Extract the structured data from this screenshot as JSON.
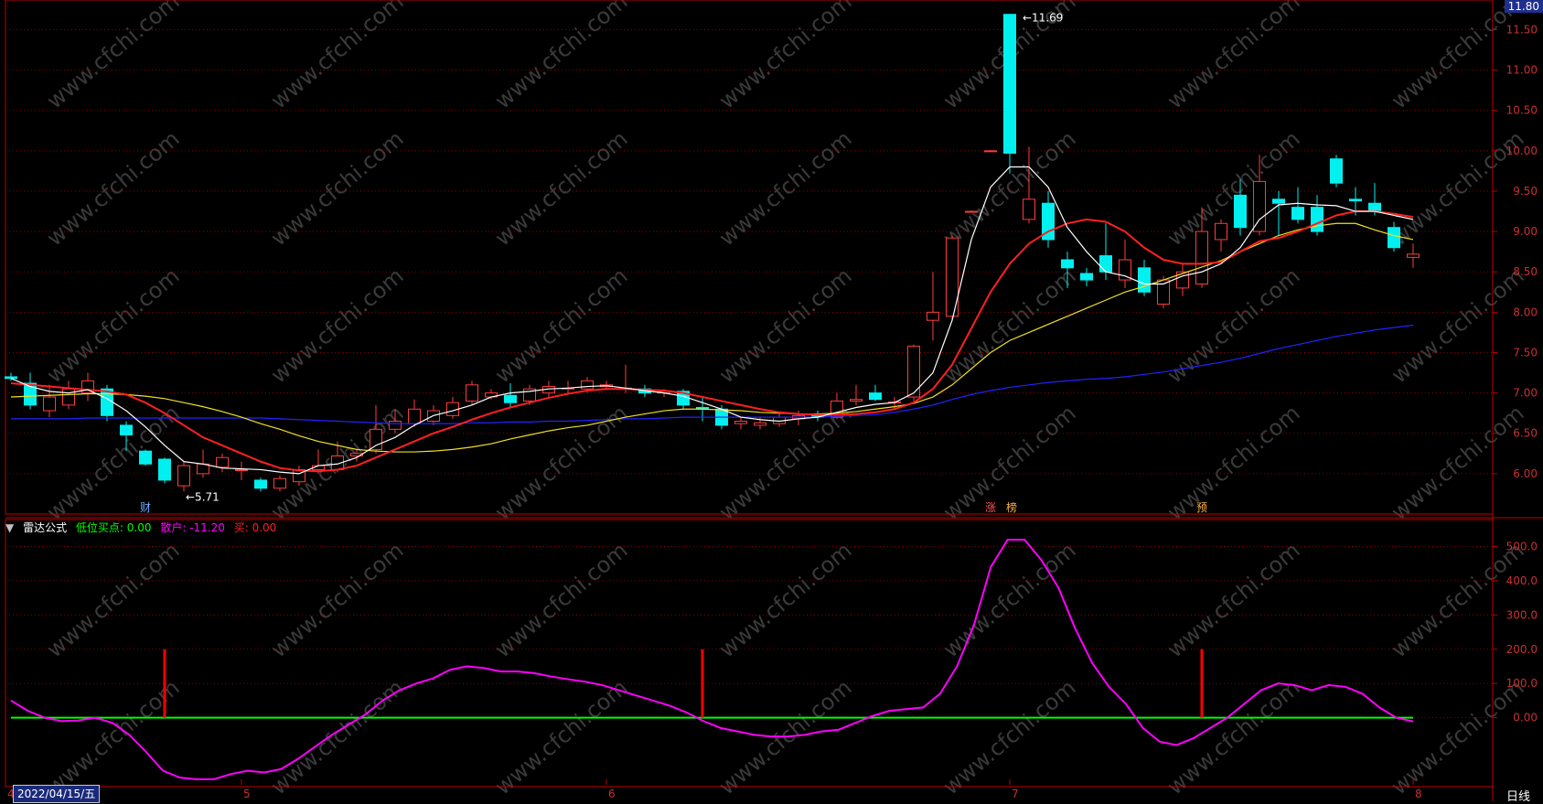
{
  "colors": {
    "up": "#ff3c3c",
    "down": "#00f0f0",
    "ma5": "#ffffff",
    "ma10": "#ff2020",
    "ma20": "#f0e020",
    "ma60": "#2222ff",
    "grid": "#8b0000",
    "axis": "#c00000",
    "zero": "#00ff00",
    "dispersal": "#ff00ff",
    "buy": "#ff0000",
    "watermark": "#3a3a3a"
  },
  "watermark": "www.cfchi.com",
  "top_price_box": "11.80",
  "annotations": {
    "high": "11.69",
    "low": "5.71"
  },
  "markers": {
    "cai": "财",
    "zhang": "涨",
    "bang": "榜",
    "yu": "预"
  },
  "indicator": {
    "title": "雷达公式",
    "low_buy_label": "低位买点:",
    "low_buy_value": "0.00",
    "retail_label": "散户:",
    "retail_value": "-11.20",
    "buy_label": "买:",
    "buy_value": "0.00"
  },
  "date_box": "2022/04/15/五",
  "period_label": "日线",
  "month_ticks": [
    {
      "label": "4",
      "index": 0
    },
    {
      "label": "5",
      "index": 12
    },
    {
      "label": "6",
      "index": 31
    },
    {
      "label": "7",
      "index": 52
    },
    {
      "label": "8",
      "index": 73
    }
  ],
  "chart_data": [
    {
      "type": "candlestick",
      "title": "",
      "ylim": [
        5.5,
        11.8
      ],
      "yticks": [
        6.0,
        6.5,
        7.0,
        7.5,
        8.0,
        8.5,
        9.0,
        9.5,
        10.0,
        10.5,
        11.0,
        11.5
      ],
      "ytick_labels": [
        "6.00",
        "6.50",
        "7.00",
        "7.50",
        "8.00",
        "8.50",
        "9.00",
        "9.50",
        "10.00",
        "10.50",
        "11.00",
        "11.50"
      ],
      "candles": [
        {
          "o": 7.2,
          "h": 7.25,
          "l": 7.15,
          "c": 7.18
        },
        {
          "o": 7.12,
          "h": 7.25,
          "l": 6.8,
          "c": 6.85
        },
        {
          "o": 6.78,
          "h": 7.1,
          "l": 6.7,
          "c": 6.95
        },
        {
          "o": 6.85,
          "h": 7.15,
          "l": 6.8,
          "c": 7.05
        },
        {
          "o": 7.0,
          "h": 7.25,
          "l": 6.9,
          "c": 7.15
        },
        {
          "o": 7.05,
          "h": 7.1,
          "l": 6.65,
          "c": 6.72
        },
        {
          "o": 6.6,
          "h": 6.65,
          "l": 6.28,
          "c": 6.48
        },
        {
          "o": 6.28,
          "h": 6.3,
          "l": 6.1,
          "c": 6.12
        },
        {
          "o": 6.18,
          "h": 6.2,
          "l": 5.88,
          "c": 5.92
        },
        {
          "o": 5.85,
          "h": 6.15,
          "l": 5.78,
          "c": 6.1
        },
        {
          "o": 6.0,
          "h": 6.3,
          "l": 5.95,
          "c": 6.12
        },
        {
          "o": 6.08,
          "h": 6.25,
          "l": 6.02,
          "c": 6.2
        },
        {
          "o": 6.05,
          "h": 6.15,
          "l": 5.92,
          "c": 6.05
        },
        {
          "o": 5.92,
          "h": 5.95,
          "l": 5.78,
          "c": 5.82
        },
        {
          "o": 5.82,
          "h": 5.98,
          "l": 5.78,
          "c": 5.94
        },
        {
          "o": 5.9,
          "h": 6.1,
          "l": 5.85,
          "c": 6.05
        },
        {
          "o": 6.05,
          "h": 6.3,
          "l": 6.0,
          "c": 6.1
        },
        {
          "o": 6.05,
          "h": 6.4,
          "l": 6.02,
          "c": 6.22
        },
        {
          "o": 6.22,
          "h": 6.3,
          "l": 6.15,
          "c": 6.25
        },
        {
          "o": 6.3,
          "h": 6.85,
          "l": 6.25,
          "c": 6.55
        },
        {
          "o": 6.55,
          "h": 6.8,
          "l": 6.5,
          "c": 6.65
        },
        {
          "o": 6.62,
          "h": 6.92,
          "l": 6.58,
          "c": 6.8
        },
        {
          "o": 6.65,
          "h": 6.85,
          "l": 6.6,
          "c": 6.78
        },
        {
          "o": 6.72,
          "h": 6.95,
          "l": 6.68,
          "c": 6.88
        },
        {
          "o": 6.9,
          "h": 7.15,
          "l": 6.85,
          "c": 7.1
        },
        {
          "o": 6.95,
          "h": 7.05,
          "l": 6.92,
          "c": 7.0
        },
        {
          "o": 6.97,
          "h": 7.12,
          "l": 6.82,
          "c": 6.88
        },
        {
          "o": 6.9,
          "h": 7.1,
          "l": 6.85,
          "c": 7.05
        },
        {
          "o": 7.0,
          "h": 7.15,
          "l": 6.95,
          "c": 7.08
        },
        {
          "o": 7.05,
          "h": 7.15,
          "l": 7.0,
          "c": 7.06
        },
        {
          "o": 7.05,
          "h": 7.2,
          "l": 7.0,
          "c": 7.15
        },
        {
          "o": 7.08,
          "h": 7.15,
          "l": 7.05,
          "c": 7.1
        },
        {
          "o": 7.05,
          "h": 7.35,
          "l": 7.0,
          "c": 7.06
        },
        {
          "o": 7.05,
          "h": 7.1,
          "l": 6.95,
          "c": 7.0
        },
        {
          "o": 7.0,
          "h": 7.05,
          "l": 6.95,
          "c": 7.02
        },
        {
          "o": 7.02,
          "h": 7.05,
          "l": 6.8,
          "c": 6.85
        },
        {
          "o": 6.82,
          "h": 6.95,
          "l": 6.65,
          "c": 6.8
        },
        {
          "o": 6.8,
          "h": 6.85,
          "l": 6.55,
          "c": 6.6
        },
        {
          "o": 6.62,
          "h": 6.7,
          "l": 6.55,
          "c": 6.65
        },
        {
          "o": 6.6,
          "h": 6.7,
          "l": 6.55,
          "c": 6.63
        },
        {
          "o": 6.62,
          "h": 6.75,
          "l": 6.58,
          "c": 6.7
        },
        {
          "o": 6.68,
          "h": 6.78,
          "l": 6.6,
          "c": 6.72
        },
        {
          "o": 6.72,
          "h": 6.78,
          "l": 6.65,
          "c": 6.7
        },
        {
          "o": 6.7,
          "h": 7.0,
          "l": 6.68,
          "c": 6.9
        },
        {
          "o": 6.9,
          "h": 7.1,
          "l": 6.85,
          "c": 6.92
        },
        {
          "o": 7.0,
          "h": 7.1,
          "l": 6.9,
          "c": 6.92
        },
        {
          "o": 6.88,
          "h": 6.95,
          "l": 6.8,
          "c": 6.89
        },
        {
          "o": 6.95,
          "h": 7.6,
          "l": 6.9,
          "c": 7.58
        },
        {
          "o": 7.9,
          "h": 8.5,
          "l": 7.65,
          "c": 8.0
        },
        {
          "o": 7.95,
          "h": 8.95,
          "l": 7.9,
          "c": 8.92
        },
        {
          "o": 9.25,
          "h": 9.26,
          "l": 9.24,
          "c": 9.25
        },
        {
          "o": 10.0,
          "h": 10.01,
          "l": 9.99,
          "c": 10.0
        },
        {
          "o": 11.69,
          "h": 11.69,
          "l": 9.72,
          "c": 9.97
        },
        {
          "o": 9.15,
          "h": 10.05,
          "l": 9.1,
          "c": 9.4
        },
        {
          "o": 9.35,
          "h": 9.5,
          "l": 8.8,
          "c": 8.9
        },
        {
          "o": 8.65,
          "h": 8.75,
          "l": 8.3,
          "c": 8.55
        },
        {
          "o": 8.48,
          "h": 8.55,
          "l": 8.32,
          "c": 8.4
        },
        {
          "o": 8.7,
          "h": 9.1,
          "l": 8.4,
          "c": 8.5
        },
        {
          "o": 8.4,
          "h": 8.9,
          "l": 8.3,
          "c": 8.65
        },
        {
          "o": 8.55,
          "h": 8.65,
          "l": 8.2,
          "c": 8.25
        },
        {
          "o": 8.1,
          "h": 8.45,
          "l": 8.05,
          "c": 8.4
        },
        {
          "o": 8.3,
          "h": 8.6,
          "l": 8.2,
          "c": 8.5
        },
        {
          "o": 8.35,
          "h": 9.3,
          "l": 8.3,
          "c": 9.0
        },
        {
          "o": 8.9,
          "h": 9.15,
          "l": 8.75,
          "c": 9.1
        },
        {
          "o": 9.45,
          "h": 9.65,
          "l": 8.95,
          "c": 9.05
        },
        {
          "o": 9.0,
          "h": 9.95,
          "l": 8.95,
          "c": 9.62
        },
        {
          "o": 9.4,
          "h": 9.5,
          "l": 8.95,
          "c": 9.35
        },
        {
          "o": 9.3,
          "h": 9.55,
          "l": 9.1,
          "c": 9.15
        },
        {
          "o": 9.3,
          "h": 9.45,
          "l": 8.95,
          "c": 9.0
        },
        {
          "o": 9.9,
          "h": 9.95,
          "l": 9.55,
          "c": 9.6
        },
        {
          "o": 9.4,
          "h": 9.55,
          "l": 9.2,
          "c": 9.38
        },
        {
          "o": 9.35,
          "h": 9.6,
          "l": 9.2,
          "c": 9.25
        },
        {
          "o": 9.05,
          "h": 9.12,
          "l": 8.75,
          "c": 8.8
        },
        {
          "o": 8.68,
          "h": 8.85,
          "l": 8.55,
          "c": 8.72
        }
      ],
      "ma5": [
        7.18,
        7.08,
        7.02,
        7.0,
        7.04,
        6.93,
        6.78,
        6.58,
        6.35,
        6.15,
        6.12,
        6.07,
        6.06,
        6.05,
        6.02,
        6.0,
        6.1,
        6.12,
        6.2,
        6.35,
        6.45,
        6.6,
        6.72,
        6.78,
        6.85,
        6.95,
        7.0,
        7.02,
        7.05,
        7.06,
        7.08,
        7.09,
        7.06,
        7.03,
        7.0,
        6.96,
        6.88,
        6.8,
        6.7,
        6.67,
        6.65,
        6.68,
        6.7,
        6.76,
        6.82,
        6.86,
        6.88,
        7.0,
        7.25,
        7.9,
        8.9,
        9.55,
        9.8,
        9.8,
        9.55,
        9.05,
        8.75,
        8.5,
        8.45,
        8.35,
        8.35,
        8.45,
        8.5,
        8.6,
        8.8,
        9.15,
        9.33,
        9.35,
        9.33,
        9.32,
        9.25,
        9.25,
        9.2,
        9.15
      ],
      "ma10": [
        7.12,
        7.1,
        7.08,
        7.06,
        7.04,
        7.02,
        6.98,
        6.88,
        6.75,
        6.6,
        6.45,
        6.35,
        6.25,
        6.15,
        6.07,
        6.04,
        6.03,
        6.05,
        6.1,
        6.2,
        6.3,
        6.4,
        6.5,
        6.58,
        6.67,
        6.75,
        6.82,
        6.88,
        6.94,
        6.99,
        7.03,
        7.05,
        7.05,
        7.04,
        7.03,
        7.0,
        6.95,
        6.9,
        6.85,
        6.8,
        6.76,
        6.74,
        6.73,
        6.73,
        6.74,
        6.76,
        6.8,
        6.88,
        7.05,
        7.35,
        7.8,
        8.25,
        8.6,
        8.85,
        9.0,
        9.1,
        9.15,
        9.12,
        9.0,
        8.8,
        8.65,
        8.6,
        8.6,
        8.62,
        8.75,
        8.88,
        8.92,
        9.0,
        9.1,
        9.2,
        9.25,
        9.25,
        9.22,
        9.18
      ],
      "ma20": [
        6.95,
        6.96,
        6.97,
        6.98,
        6.99,
        6.99,
        6.98,
        6.96,
        6.93,
        6.88,
        6.83,
        6.77,
        6.7,
        6.62,
        6.55,
        6.47,
        6.4,
        6.35,
        6.3,
        6.28,
        6.27,
        6.27,
        6.28,
        6.3,
        6.33,
        6.37,
        6.43,
        6.48,
        6.53,
        6.57,
        6.6,
        6.65,
        6.7,
        6.74,
        6.78,
        6.8,
        6.8,
        6.79,
        6.78,
        6.76,
        6.75,
        6.74,
        6.74,
        6.75,
        6.77,
        6.8,
        6.83,
        6.87,
        6.95,
        7.1,
        7.3,
        7.5,
        7.65,
        7.75,
        7.85,
        7.95,
        8.05,
        8.15,
        8.25,
        8.32,
        8.4,
        8.48,
        8.56,
        8.64,
        8.75,
        8.85,
        8.95,
        9.02,
        9.07,
        9.1,
        9.1,
        9.02,
        8.95,
        8.9
      ],
      "ma60": [
        6.68,
        6.68,
        6.68,
        6.68,
        6.69,
        6.69,
        6.69,
        6.69,
        6.69,
        6.69,
        6.69,
        6.69,
        6.69,
        6.69,
        6.68,
        6.67,
        6.66,
        6.65,
        6.64,
        6.63,
        6.62,
        6.62,
        6.62,
        6.62,
        6.63,
        6.63,
        6.64,
        6.64,
        6.65,
        6.65,
        6.66,
        6.67,
        6.68,
        6.68,
        6.69,
        6.7,
        6.7,
        6.7,
        6.7,
        6.7,
        6.7,
        6.7,
        6.7,
        6.71,
        6.72,
        6.73,
        6.76,
        6.8,
        6.85,
        6.92,
        6.98,
        7.03,
        7.07,
        7.1,
        7.13,
        7.15,
        7.17,
        7.18,
        7.2,
        7.23,
        7.26,
        7.3,
        7.34,
        7.38,
        7.43,
        7.49,
        7.55,
        7.6,
        7.65,
        7.7,
        7.74,
        7.78,
        7.81,
        7.84
      ]
    },
    {
      "type": "line",
      "title": "雷达公式",
      "ylim": [
        -180,
        560
      ],
      "yticks": [
        0,
        100,
        200,
        300,
        400,
        500
      ],
      "ytick_labels": [
        "0.00",
        "100.0",
        "200.0",
        "300.0",
        "400.0",
        "500.0"
      ],
      "series": [
        {
          "name": "散户",
          "values": [
            50,
            20,
            0,
            -10,
            -8,
            0,
            -15,
            -50,
            -100,
            -155,
            -175,
            -180,
            -180,
            -165,
            -155,
            -160,
            -150,
            -120,
            -85,
            -50,
            -20,
            10,
            50,
            80,
            100,
            115,
            140,
            150,
            145,
            135,
            135,
            130,
            120,
            112,
            105,
            95,
            80,
            65,
            50,
            35,
            15,
            -10,
            -30,
            -40,
            -50,
            -55,
            -55,
            -50,
            -40,
            -35,
            -15,
            5,
            20,
            25,
            30,
            70,
            150,
            270,
            440,
            520,
            520,
            460,
            380,
            260,
            160,
            90,
            40,
            -30,
            -70,
            -80,
            -60,
            -30,
            0,
            40,
            80,
            100,
            95,
            80,
            95,
            90,
            70,
            30,
            0,
            -11
          ]
        },
        {
          "name": "低位买点",
          "values": [
            0
          ]
        },
        {
          "name": "买",
          "spikes": [
            {
              "index": 8,
              "value": 200
            },
            {
              "index": 36,
              "value": 200
            },
            {
              "index": 62,
              "value": 200
            }
          ]
        }
      ]
    }
  ]
}
